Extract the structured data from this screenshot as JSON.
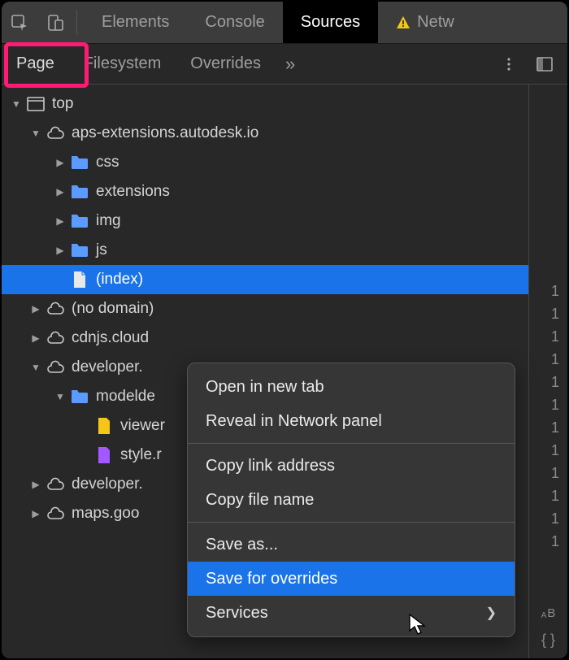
{
  "topTabs": {
    "elements": "Elements",
    "console": "Console",
    "sources": "Sources",
    "network": "Netw"
  },
  "subTabs": {
    "page": "Page",
    "filesystem": "Filesystem",
    "overrides": "Overrides",
    "more": "»"
  },
  "tree": {
    "top": "top",
    "domain1": "aps-extensions.autodesk.io",
    "css": "css",
    "extensions": "extensions",
    "img": "img",
    "js": "js",
    "index": "(index)",
    "noDomain": "(no domain)",
    "cdnjs": "cdnjs.cloud",
    "developer": "developer.",
    "modelde": "modelde",
    "viewer": "viewer",
    "style": "style.r",
    "developer2": "developer.",
    "maps": "maps.goo"
  },
  "contextMenu": {
    "openNewTab": "Open in new tab",
    "revealNetwork": "Reveal in Network panel",
    "copyLink": "Copy link address",
    "copyFile": "Copy file name",
    "saveAs": "Save as...",
    "saveOverrides": "Save for overrides",
    "services": "Services"
  },
  "lineNumbers": [
    "1",
    "1",
    "1",
    "1",
    "1",
    "1",
    "1",
    "1",
    "1",
    "1",
    "1",
    "1"
  ],
  "codeLabel": "B"
}
